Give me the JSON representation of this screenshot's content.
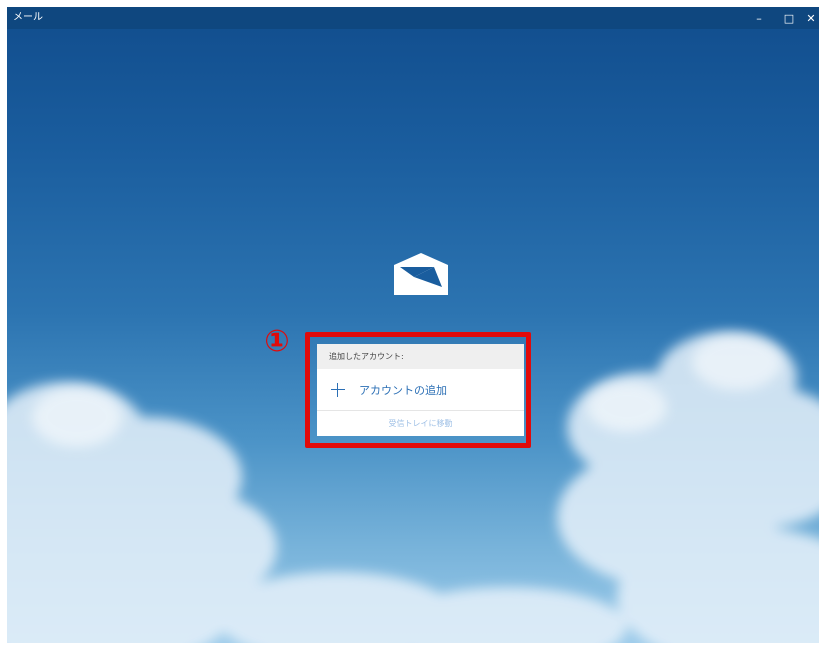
{
  "window": {
    "title": "メール",
    "controls": {
      "minimize": "–",
      "maximize": "□",
      "close": "✕"
    }
  },
  "logo": {
    "icon": "mail-envelope-icon"
  },
  "callout": {
    "number": "①"
  },
  "account_panel": {
    "header": "追加したアカウント:",
    "add_account_label": "アカウントの追加",
    "go_to_inbox_label": "受信トレイに移動"
  },
  "colors": {
    "titlebar": "#0f477f",
    "accent": "#2b6fb5",
    "highlight": "#e10a0a",
    "disabled_link": "#9fc0e6"
  }
}
